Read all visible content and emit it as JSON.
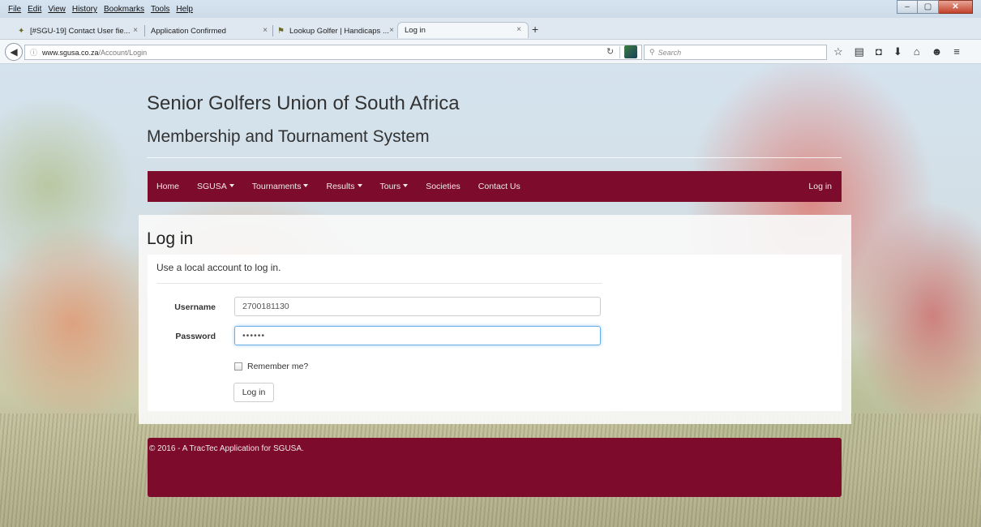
{
  "browser": {
    "menu": [
      "File",
      "Edit",
      "View",
      "History",
      "Bookmarks",
      "Tools",
      "Help"
    ],
    "tabs": [
      {
        "label": "[#SGU-19] Contact User fie..."
      },
      {
        "label": "Application Confirmed"
      },
      {
        "label": "Lookup Golfer | Handicaps ..."
      },
      {
        "label": "Log in"
      }
    ],
    "new_tab": "+",
    "url_host": "www.sgusa.co.za",
    "url_path": "/Account/Login",
    "search_placeholder": "Search"
  },
  "site": {
    "title": "Senior Golfers Union of South Africa",
    "subtitle": "Membership and Tournament System",
    "accent_color": "#7d0b2c"
  },
  "nav": {
    "items": [
      {
        "label": "Home",
        "dropdown": false
      },
      {
        "label": "SGUSA",
        "dropdown": true
      },
      {
        "label": "Tournaments",
        "dropdown": true
      },
      {
        "label": "Results",
        "dropdown": true
      },
      {
        "label": "Tours",
        "dropdown": true
      },
      {
        "label": "Societies",
        "dropdown": false
      },
      {
        "label": "Contact Us",
        "dropdown": false
      }
    ],
    "login": "Log in"
  },
  "login": {
    "heading": "Log in",
    "lead": "Use a local account to log in.",
    "username_label": "Username",
    "username_value": "2700181130",
    "password_label": "Password",
    "password_value": "••••••",
    "remember_label": "Remember me?",
    "submit_label": "Log in"
  },
  "footer": {
    "text": "© 2016 - A TracTec Application for SGUSA."
  }
}
